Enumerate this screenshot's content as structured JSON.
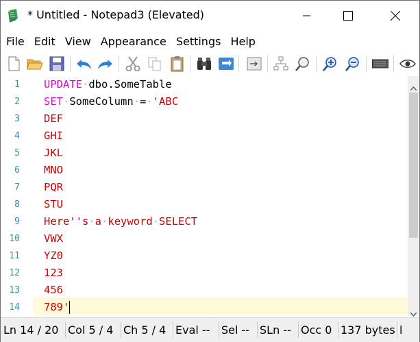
{
  "window": {
    "title": "* Untitled - Notepad3 (Elevated)"
  },
  "menu": [
    "File",
    "Edit",
    "View",
    "Appearance",
    "Settings",
    "Help"
  ],
  "toolbar": {
    "buttons": [
      "new-file-icon",
      "open-folder-icon",
      "save-icon",
      "undo-icon",
      "redo-icon",
      "cut-icon",
      "copy-icon",
      "paste-icon",
      "find-icon",
      "replace-icon",
      "goto-line-icon",
      "scheme-icon",
      "zoom-find-icon",
      "zoom-in-icon",
      "zoom-out-icon",
      "keyboard-icon",
      "view-eye-icon"
    ]
  },
  "editor": {
    "line_numbers": [
      "1",
      "2",
      "3",
      "4",
      "5",
      "6",
      "7",
      "8",
      "9",
      "10",
      "11",
      "12",
      "13",
      "14"
    ],
    "lines": [
      [
        {
          "t": "UPDATE",
          "c": "kw"
        },
        {
          "t": "·",
          "c": "dot"
        },
        {
          "t": "dbo.SomeTable",
          "c": "id"
        }
      ],
      [
        {
          "t": "SET",
          "c": "kw"
        },
        {
          "t": "·",
          "c": "dot"
        },
        {
          "t": "SomeColumn",
          "c": "id"
        },
        {
          "t": "·",
          "c": "dot"
        },
        {
          "t": "=",
          "c": "op"
        },
        {
          "t": "·",
          "c": "dot"
        },
        {
          "t": "'ABC",
          "c": "str"
        }
      ],
      [
        {
          "t": "DEF",
          "c": "str"
        }
      ],
      [
        {
          "t": "GHI",
          "c": "str"
        }
      ],
      [
        {
          "t": "JKL",
          "c": "str"
        }
      ],
      [
        {
          "t": "MNO",
          "c": "str"
        }
      ],
      [
        {
          "t": "PQR",
          "c": "str"
        }
      ],
      [
        {
          "t": "STU",
          "c": "str"
        }
      ],
      [
        {
          "t": "Here''s",
          "c": "str"
        },
        {
          "t": "·",
          "c": "dot"
        },
        {
          "t": "a",
          "c": "str"
        },
        {
          "t": "·",
          "c": "dot"
        },
        {
          "t": "keyword",
          "c": "str"
        },
        {
          "t": "·",
          "c": "dot"
        },
        {
          "t": "SELECT",
          "c": "str"
        }
      ],
      [
        {
          "t": "VWX",
          "c": "str"
        }
      ],
      [
        {
          "t": "YZ0",
          "c": "str"
        }
      ],
      [
        {
          "t": "123",
          "c": "str"
        }
      ],
      [
        {
          "t": "456",
          "c": "str"
        }
      ],
      [
        {
          "t": "789'",
          "c": "str"
        }
      ]
    ]
  },
  "status": {
    "ln": "Ln  14 / 20",
    "col": "Col  5 / 4",
    "ch": "Ch  5 / 4",
    "eval": "Eval  --",
    "sel": "Sel  --",
    "sln": "SLn  --",
    "occ": "Occ  0",
    "bytes": "137 bytes",
    "trailing": "l"
  }
}
